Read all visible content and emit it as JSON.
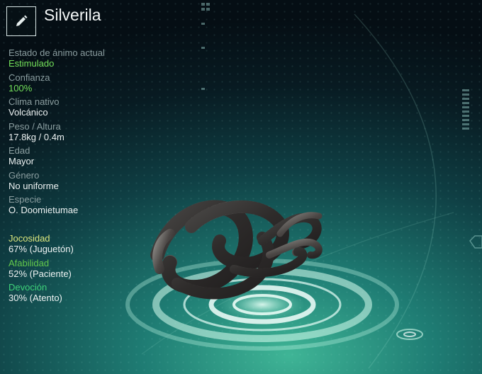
{
  "creature": {
    "name": "Silverila",
    "edit_icon": "pencil-icon"
  },
  "stats": [
    {
      "label": "Estado de ánimo actual",
      "value": "Estimulado"
    },
    {
      "label": "Confianza",
      "value": "100%"
    },
    {
      "label": "Clima nativo",
      "value": "Volcánico"
    },
    {
      "label": "Peso / Altura",
      "value": "17.8kg / 0.4m"
    },
    {
      "label": "Edad",
      "value": "Mayor"
    },
    {
      "label": "Género",
      "value": "No uniforme"
    },
    {
      "label": "Especie",
      "value": "O. Doomietumae"
    }
  ],
  "traits": [
    {
      "label": "Jocosidad",
      "value": "67% (Juguetón)"
    },
    {
      "label": "Afabilidad",
      "value": "52% (Paciente)"
    },
    {
      "label": "Devoción",
      "value": "30% (Atento)"
    }
  ],
  "colors": {
    "accent_green": "#73e05a",
    "trait_playfulness": "#dbe67c",
    "trait_friendliness": "#63c94c",
    "trait_devotion": "#3fd37a"
  }
}
